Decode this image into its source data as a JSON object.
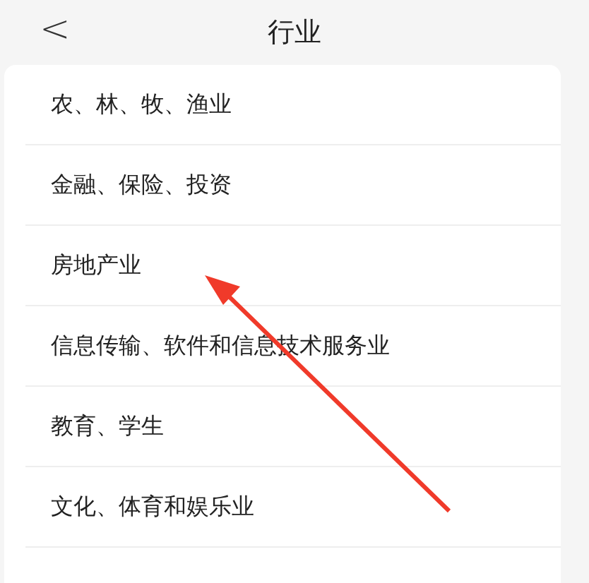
{
  "header": {
    "back": "<",
    "title": "行业"
  },
  "industries": [
    {
      "label": "农、林、牧、渔业"
    },
    {
      "label": "金融、保险、投资"
    },
    {
      "label": "房地产业"
    },
    {
      "label": "信息传输、软件和信息技术服务业"
    },
    {
      "label": "教育、学生"
    },
    {
      "label": "文化、体育和娱乐业"
    }
  ]
}
